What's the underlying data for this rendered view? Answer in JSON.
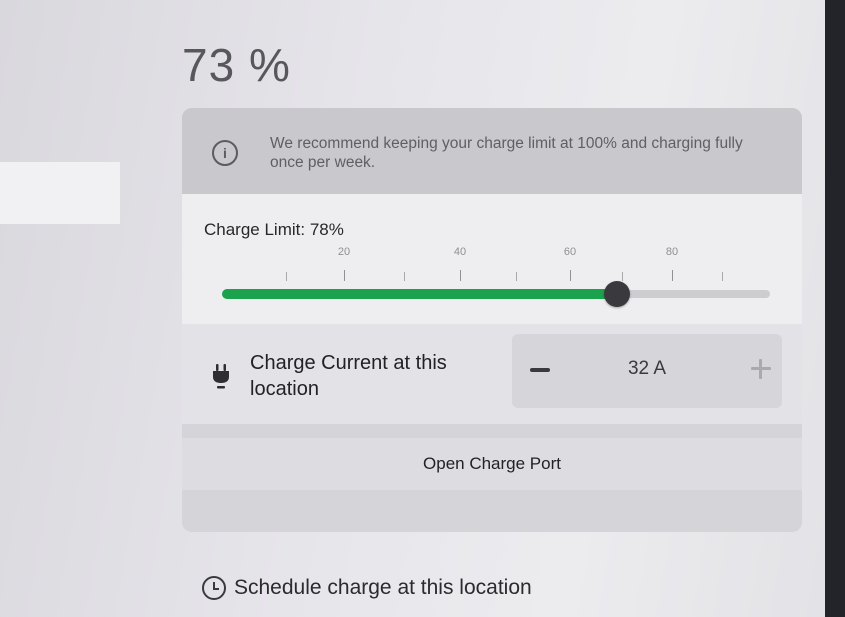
{
  "battery": {
    "percent_text": "73 %"
  },
  "info": {
    "icon": "info-circle-icon",
    "text": "We recommend keeping your charge limit at 100% and charging fully once per week."
  },
  "charge_limit": {
    "label": "Charge Limit: 78%",
    "value_percent": 78,
    "scale_labels": [
      "20",
      "40",
      "60",
      "80"
    ],
    "fill_color": "#1aa34c"
  },
  "charge_current": {
    "icon": "plug-icon",
    "label": "Charge Current at this location",
    "value": "32 A",
    "decrease_icon": "minus-icon",
    "increase_icon": "plus-icon"
  },
  "charge_port": {
    "button_label": "Open Charge Port"
  },
  "schedule": {
    "icon": "clock-icon",
    "label": "Schedule charge at this location"
  }
}
